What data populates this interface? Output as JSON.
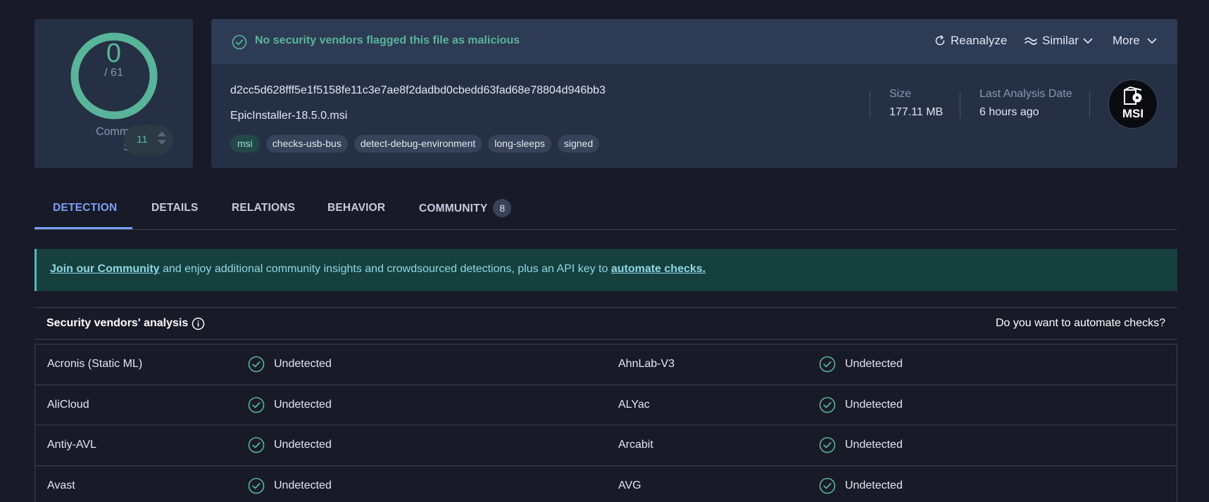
{
  "score": {
    "detections": "0",
    "total": "/ 61",
    "community_label_line1": "Community",
    "community_label_line2": "Score",
    "community_value": "11"
  },
  "banner": {
    "status_text": "No security vendors flagged this file as malicious",
    "actions": {
      "reanalyze": "Reanalyze",
      "similar": "Similar",
      "more": "More"
    }
  },
  "file": {
    "hash": "d2cc5d628fff5e1f5158fe11c3e7ae8f2dadbd0cbedd63fad68e78804d946bb3",
    "name": "EpicInstaller-18.5.0.msi",
    "tags": [
      "msi",
      "checks-usb-bus",
      "detect-debug-environment",
      "long-sleeps",
      "signed"
    ],
    "size_label": "Size",
    "size_value": "177.11 MB",
    "date_label": "Last Analysis Date",
    "date_value": "6 hours ago",
    "type_badge": "MSI"
  },
  "tabs": {
    "detection": "DETECTION",
    "details": "DETAILS",
    "relations": "RELATIONS",
    "behavior": "BEHAVIOR",
    "community": "COMMUNITY",
    "community_count": "8"
  },
  "join": {
    "link1": "Join our Community",
    "text": " and enjoy additional community insights and crowdsourced detections, plus an API key to ",
    "link2": "automate checks."
  },
  "vendors": {
    "title": "Security vendors' analysis",
    "automate_prompt": "Do you want to automate checks?",
    "rows": [
      [
        {
          "name": "Acronis (Static ML)",
          "result": "Undetected"
        },
        {
          "name": "AhnLab-V3",
          "result": "Undetected"
        }
      ],
      [
        {
          "name": "AliCloud",
          "result": "Undetected"
        },
        {
          "name": "ALYac",
          "result": "Undetected"
        }
      ],
      [
        {
          "name": "Antiy-AVL",
          "result": "Undetected"
        },
        {
          "name": "Arcabit",
          "result": "Undetected"
        }
      ],
      [
        {
          "name": "Avast",
          "result": "Undetected"
        },
        {
          "name": "AVG",
          "result": "Undetected"
        }
      ]
    ]
  },
  "colors": {
    "background": "#191a28",
    "card": "#263045",
    "accent_green": "#59b59a",
    "accent_blue": "#7aa0f5",
    "join_banner": "#15403d"
  },
  "icons": {
    "status": "check-circle-icon",
    "reanalyze": "refresh-icon",
    "similar": "approx-icon",
    "dropdown": "chevron-down-icon",
    "info": "info-icon",
    "file_type": "msi-file-icon"
  }
}
